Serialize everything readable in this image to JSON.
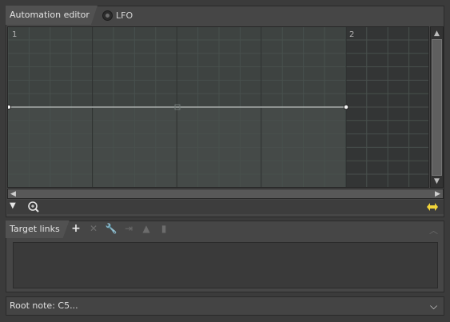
{
  "automation_editor": {
    "tab_label": "Automation editor",
    "lfo_label": "LFO",
    "bar_markers": [
      "1",
      "2"
    ],
    "accent_color": "#f2d43a",
    "icons": {
      "dropdown": "triangle-down-icon",
      "zoom": "zoom-icon",
      "fit": "fit-horizontal-icon"
    }
  },
  "target_links": {
    "tab_label": "Target links",
    "tools": [
      {
        "name": "add-icon",
        "glyph": "+",
        "enabled": true
      },
      {
        "name": "remove-icon",
        "glyph": "✕",
        "enabled": false
      },
      {
        "name": "wrench-icon",
        "glyph": "🔧",
        "enabled": false
      },
      {
        "name": "link-in-icon",
        "glyph": "⇥",
        "enabled": false
      },
      {
        "name": "stamp-icon",
        "glyph": "▲",
        "enabled": false
      },
      {
        "name": "levels-icon",
        "glyph": "▮",
        "enabled": false
      }
    ]
  },
  "root_note": {
    "label": "Root note: C5..."
  }
}
